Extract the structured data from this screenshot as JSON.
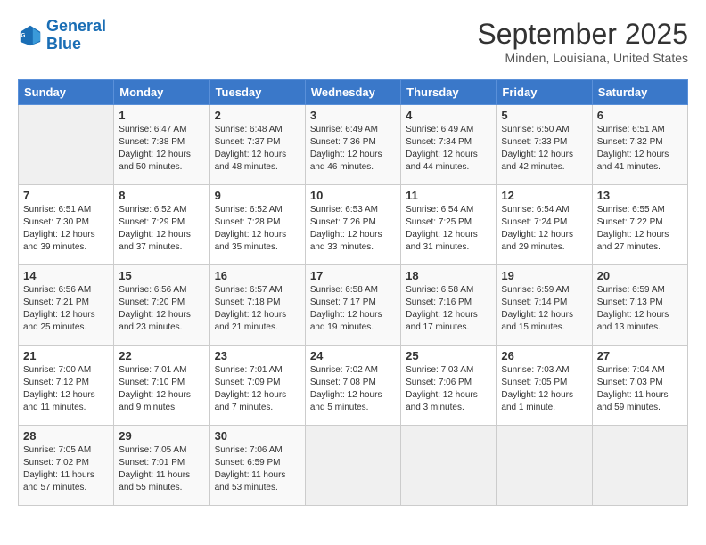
{
  "logo": {
    "line1": "General",
    "line2": "Blue"
  },
  "title": "September 2025",
  "location": "Minden, Louisiana, United States",
  "header_days": [
    "Sunday",
    "Monday",
    "Tuesday",
    "Wednesday",
    "Thursday",
    "Friday",
    "Saturday"
  ],
  "weeks": [
    [
      {
        "day": "",
        "info": ""
      },
      {
        "day": "1",
        "info": "Sunrise: 6:47 AM\nSunset: 7:38 PM\nDaylight: 12 hours\nand 50 minutes."
      },
      {
        "day": "2",
        "info": "Sunrise: 6:48 AM\nSunset: 7:37 PM\nDaylight: 12 hours\nand 48 minutes."
      },
      {
        "day": "3",
        "info": "Sunrise: 6:49 AM\nSunset: 7:36 PM\nDaylight: 12 hours\nand 46 minutes."
      },
      {
        "day": "4",
        "info": "Sunrise: 6:49 AM\nSunset: 7:34 PM\nDaylight: 12 hours\nand 44 minutes."
      },
      {
        "day": "5",
        "info": "Sunrise: 6:50 AM\nSunset: 7:33 PM\nDaylight: 12 hours\nand 42 minutes."
      },
      {
        "day": "6",
        "info": "Sunrise: 6:51 AM\nSunset: 7:32 PM\nDaylight: 12 hours\nand 41 minutes."
      }
    ],
    [
      {
        "day": "7",
        "info": "Sunrise: 6:51 AM\nSunset: 7:30 PM\nDaylight: 12 hours\nand 39 minutes."
      },
      {
        "day": "8",
        "info": "Sunrise: 6:52 AM\nSunset: 7:29 PM\nDaylight: 12 hours\nand 37 minutes."
      },
      {
        "day": "9",
        "info": "Sunrise: 6:52 AM\nSunset: 7:28 PM\nDaylight: 12 hours\nand 35 minutes."
      },
      {
        "day": "10",
        "info": "Sunrise: 6:53 AM\nSunset: 7:26 PM\nDaylight: 12 hours\nand 33 minutes."
      },
      {
        "day": "11",
        "info": "Sunrise: 6:54 AM\nSunset: 7:25 PM\nDaylight: 12 hours\nand 31 minutes."
      },
      {
        "day": "12",
        "info": "Sunrise: 6:54 AM\nSunset: 7:24 PM\nDaylight: 12 hours\nand 29 minutes."
      },
      {
        "day": "13",
        "info": "Sunrise: 6:55 AM\nSunset: 7:22 PM\nDaylight: 12 hours\nand 27 minutes."
      }
    ],
    [
      {
        "day": "14",
        "info": "Sunrise: 6:56 AM\nSunset: 7:21 PM\nDaylight: 12 hours\nand 25 minutes."
      },
      {
        "day": "15",
        "info": "Sunrise: 6:56 AM\nSunset: 7:20 PM\nDaylight: 12 hours\nand 23 minutes."
      },
      {
        "day": "16",
        "info": "Sunrise: 6:57 AM\nSunset: 7:18 PM\nDaylight: 12 hours\nand 21 minutes."
      },
      {
        "day": "17",
        "info": "Sunrise: 6:58 AM\nSunset: 7:17 PM\nDaylight: 12 hours\nand 19 minutes."
      },
      {
        "day": "18",
        "info": "Sunrise: 6:58 AM\nSunset: 7:16 PM\nDaylight: 12 hours\nand 17 minutes."
      },
      {
        "day": "19",
        "info": "Sunrise: 6:59 AM\nSunset: 7:14 PM\nDaylight: 12 hours\nand 15 minutes."
      },
      {
        "day": "20",
        "info": "Sunrise: 6:59 AM\nSunset: 7:13 PM\nDaylight: 12 hours\nand 13 minutes."
      }
    ],
    [
      {
        "day": "21",
        "info": "Sunrise: 7:00 AM\nSunset: 7:12 PM\nDaylight: 12 hours\nand 11 minutes."
      },
      {
        "day": "22",
        "info": "Sunrise: 7:01 AM\nSunset: 7:10 PM\nDaylight: 12 hours\nand 9 minutes."
      },
      {
        "day": "23",
        "info": "Sunrise: 7:01 AM\nSunset: 7:09 PM\nDaylight: 12 hours\nand 7 minutes."
      },
      {
        "day": "24",
        "info": "Sunrise: 7:02 AM\nSunset: 7:08 PM\nDaylight: 12 hours\nand 5 minutes."
      },
      {
        "day": "25",
        "info": "Sunrise: 7:03 AM\nSunset: 7:06 PM\nDaylight: 12 hours\nand 3 minutes."
      },
      {
        "day": "26",
        "info": "Sunrise: 7:03 AM\nSunset: 7:05 PM\nDaylight: 12 hours\nand 1 minute."
      },
      {
        "day": "27",
        "info": "Sunrise: 7:04 AM\nSunset: 7:03 PM\nDaylight: 11 hours\nand 59 minutes."
      }
    ],
    [
      {
        "day": "28",
        "info": "Sunrise: 7:05 AM\nSunset: 7:02 PM\nDaylight: 11 hours\nand 57 minutes."
      },
      {
        "day": "29",
        "info": "Sunrise: 7:05 AM\nSunset: 7:01 PM\nDaylight: 11 hours\nand 55 minutes."
      },
      {
        "day": "30",
        "info": "Sunrise: 7:06 AM\nSunset: 6:59 PM\nDaylight: 11 hours\nand 53 minutes."
      },
      {
        "day": "",
        "info": ""
      },
      {
        "day": "",
        "info": ""
      },
      {
        "day": "",
        "info": ""
      },
      {
        "day": "",
        "info": ""
      }
    ]
  ]
}
